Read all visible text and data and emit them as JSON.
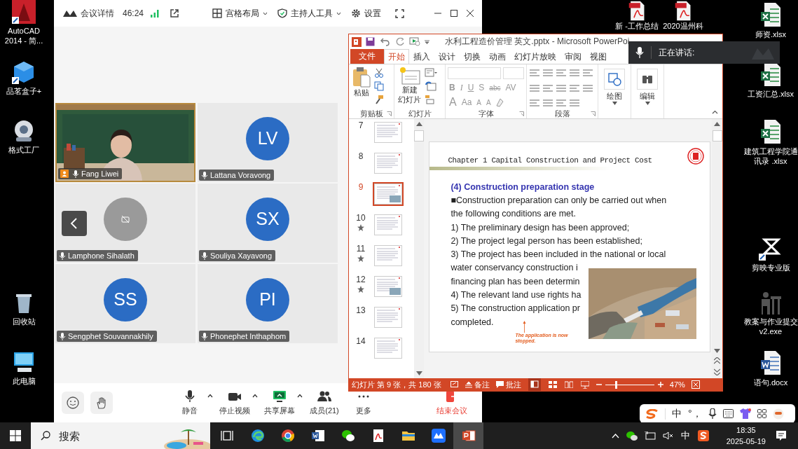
{
  "desktop": {
    "left_icons": [
      {
        "label": "AutoCAD 2014 - 简...",
        "kind": "autocad"
      },
      {
        "label": "品茗盒子+",
        "kind": "cube"
      },
      {
        "label": "格式工厂",
        "kind": "factory"
      },
      {
        "label": "回收站",
        "kind": "recycle"
      },
      {
        "label": "此电脑",
        "kind": "computer"
      }
    ],
    "top_icons": [
      {
        "label": "新 -工作总结",
        "kind": "pdf"
      },
      {
        "label": "2020温州科",
        "kind": "pdf"
      }
    ],
    "right_icons": [
      {
        "label": "师资.xlsx",
        "kind": "excel"
      },
      {
        "label": "工资汇总.xlsx",
        "kind": "excel"
      },
      {
        "label": "建筑工程学院通讯录 .xlsx",
        "kind": "excel"
      },
      {
        "label": "剪映专业版",
        "kind": "capcut"
      },
      {
        "label": "教案与作业提交v2.exe",
        "kind": "app"
      },
      {
        "label": "语句.docx",
        "kind": "word"
      }
    ]
  },
  "meeting": {
    "title": "会议详情",
    "duration": "46:24",
    "tools": [
      {
        "label": "宫格布局",
        "kind": "grid"
      },
      {
        "label": "主持人工具",
        "kind": "shield"
      },
      {
        "label": "设置",
        "kind": "gear"
      }
    ],
    "participants": [
      {
        "name": "Fang Liwei",
        "kind": "video",
        "host": true
      },
      {
        "name": "Lattana Voravong",
        "kind": "avatar",
        "initials": "LV",
        "host": false
      },
      {
        "name": "Lamphone Sihalath",
        "kind": "camera_off",
        "host": false
      },
      {
        "name": "Souliya Xayavong",
        "kind": "avatar",
        "initials": "SX",
        "host": false
      },
      {
        "name": "Sengphet Souvannakhily",
        "kind": "avatar",
        "initials": "SS",
        "host": false
      },
      {
        "name": "Phonephet Inthaphom",
        "kind": "avatar",
        "initials": "PI",
        "host": false
      }
    ],
    "controls": [
      {
        "label": "静音",
        "kind": "mic",
        "caret": true
      },
      {
        "label": "停止视频",
        "kind": "video",
        "caret": true
      },
      {
        "label": "共享屏幕",
        "kind": "share",
        "caret": true
      },
      {
        "label": "成员(21)",
        "kind": "members",
        "caret": false
      },
      {
        "label": "更多",
        "kind": "more",
        "caret": false
      }
    ],
    "end_button": "结束会议"
  },
  "powerpoint": {
    "title": "水利工程造价管理 英文.pptx - Microsoft PowerPoi",
    "file_tab": "文件",
    "tabs": [
      {
        "label": "开始",
        "selected": true
      },
      {
        "label": "插入",
        "selected": false
      },
      {
        "label": "设计",
        "selected": false
      },
      {
        "label": "切换",
        "selected": false
      },
      {
        "label": "动画",
        "selected": false
      },
      {
        "label": "幻灯片放映",
        "selected": false
      },
      {
        "label": "审阅",
        "selected": false
      },
      {
        "label": "视图",
        "selected": false
      }
    ],
    "ribbon": [
      {
        "kind": "clipboard",
        "label": "剪贴板",
        "button": "粘贴"
      },
      {
        "kind": "slides",
        "label": "幻灯片",
        "button": [
          "新建",
          "幻灯片"
        ]
      },
      {
        "kind": "font",
        "label": "字体",
        "buttons": [
          "B",
          "I",
          "U",
          "S",
          "abc",
          "AV",
          "A",
          "Aa",
          "A",
          "A"
        ]
      },
      {
        "kind": "paragraph",
        "label": "段落"
      },
      {
        "kind": "draw",
        "button": "绘图"
      },
      {
        "kind": "edit",
        "button": "编辑"
      }
    ],
    "thumbnails": [
      {
        "number": "7",
        "selected": false,
        "animated": false
      },
      {
        "number": "8",
        "selected": false,
        "animated": false
      },
      {
        "number": "9",
        "selected": true,
        "animated": false
      },
      {
        "number": "10",
        "selected": false,
        "animated": true
      },
      {
        "number": "11",
        "selected": false,
        "animated": true
      },
      {
        "number": "12",
        "selected": false,
        "animated": true
      },
      {
        "number": "13",
        "selected": false,
        "animated": false
      },
      {
        "number": "14",
        "selected": false,
        "animated": false
      }
    ],
    "slide": {
      "title": "Chapter 1 Capital Construction and Project Cost",
      "heading": "(4) Construction preparation stage",
      "lines": [
        "■Construction preparation can only be carried out when",
        "the following conditions are met.",
        "1) The preliminary design has been approved;",
        "2) The project legal person has been established;",
        "3) The project has been included in the national or local",
        "water conservancy construction i",
        "financing plan has been determin",
        "4) The relevant land use rights ha",
        "5) The construction application pr",
        "completed."
      ],
      "note": "The application is now stopped."
    },
    "status": {
      "slide_info": "幻灯片 第 9 张，共 180 张",
      "notes": "备注",
      "comments": "批注",
      "level": 0.22,
      "zoom": "47%"
    }
  },
  "speaking": {
    "label": "正在讲话:"
  },
  "ime_bar": {
    "mode": "中",
    "punct": "°，"
  },
  "taskbar": {
    "search_placeholder": "搜索",
    "apps": [
      {
        "kind": "taskview",
        "selected": false
      },
      {
        "kind": "edge",
        "selected": false
      },
      {
        "kind": "chrome",
        "selected": false
      },
      {
        "kind": "word",
        "selected": false
      },
      {
        "kind": "wechat",
        "selected": false
      },
      {
        "kind": "acrobat",
        "selected": false
      },
      {
        "kind": "explorer",
        "selected": false
      },
      {
        "kind": "meeting",
        "selected": false
      },
      {
        "kind": "powerpoint",
        "selected": true
      }
    ],
    "ime": "中",
    "time": "18:35",
    "date": "2025-05-19"
  }
}
